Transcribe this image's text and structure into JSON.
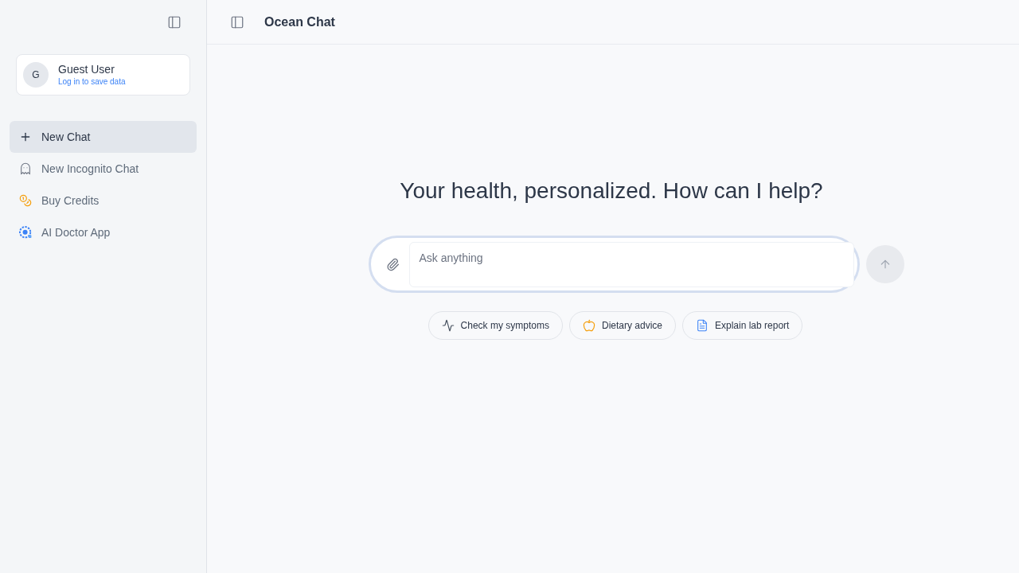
{
  "sidebar": {
    "user": {
      "avatar": "G",
      "name": "Guest User",
      "link": "Log in to save data"
    },
    "items": [
      {
        "kind": "new",
        "label": "New Chat",
        "selected": true
      },
      {
        "kind": "incognito",
        "label": "New Incognito Chat",
        "selected": false
      },
      {
        "kind": "credits",
        "label": "Buy Credits",
        "selected": false
      },
      {
        "kind": "app",
        "label": "AI Doctor App",
        "selected": false
      }
    ]
  },
  "header": {
    "title": "Ocean Chat"
  },
  "main": {
    "heading": "Your health, personalized. How can I help?",
    "input": {
      "placeholder": "Ask anything"
    },
    "suggestions": [
      {
        "kind": "symptoms",
        "label": "Check my symptoms"
      },
      {
        "kind": "diet",
        "label": "Dietary advice"
      },
      {
        "kind": "lab",
        "label": "Explain lab report"
      }
    ]
  }
}
